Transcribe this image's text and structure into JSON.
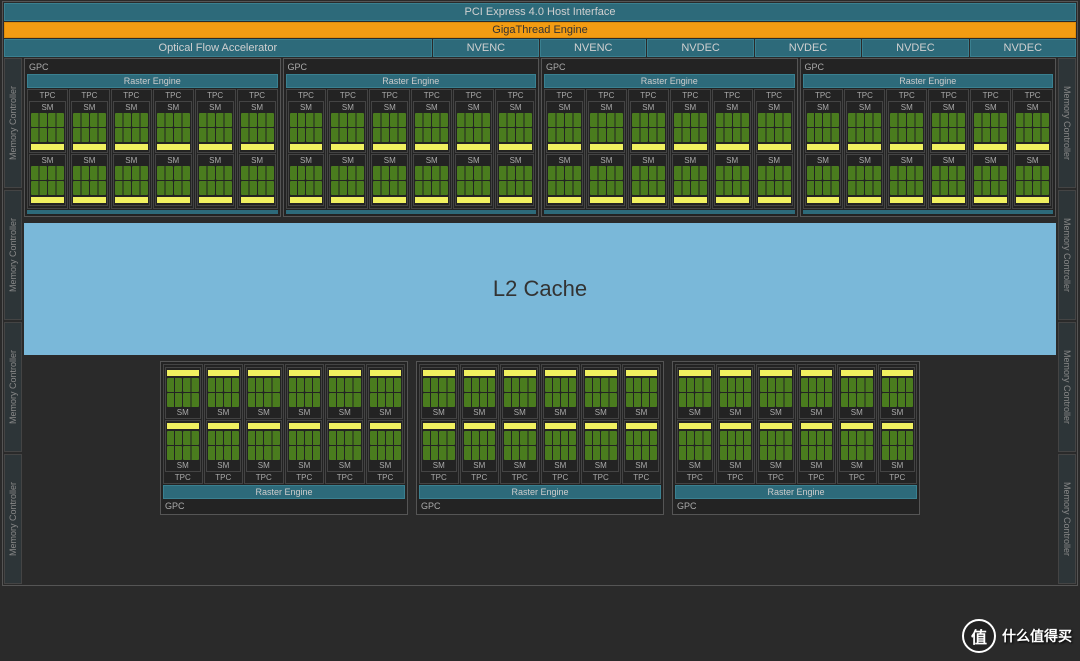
{
  "top": {
    "pci": "PCI Express 4.0 Host Interface",
    "giga": "GigaThread Engine",
    "ofa": "Optical Flow Accelerator",
    "eng": [
      "NVENC",
      "NVENC",
      "NVDEC",
      "NVDEC",
      "NVDEC",
      "NVDEC"
    ]
  },
  "mc": "Memory Controller",
  "gpc": {
    "label": "GPC",
    "raster": "Raster Engine",
    "tpc": "TPC",
    "sm": "SM",
    "top_count": 4,
    "bottom_count": 3,
    "tpc_per_gpc": 6,
    "sm_per_tpc": 2
  },
  "l2": "L2 Cache",
  "watermark": {
    "badge": "值",
    "text": "什么值得买"
  }
}
